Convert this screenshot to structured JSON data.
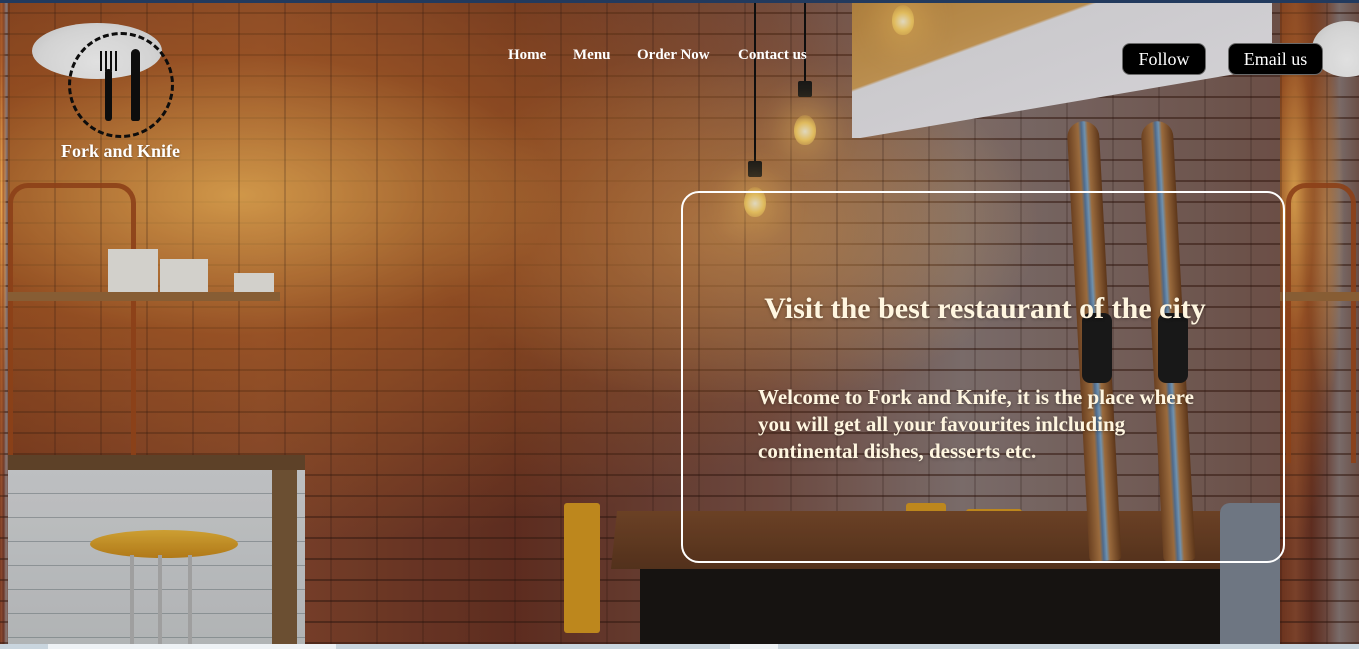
{
  "brand": {
    "name": "Fork and Knife",
    "logo_icon": "fork-and-knife-icon"
  },
  "nav": {
    "items": [
      {
        "label": "Home"
      },
      {
        "label": "Menu"
      },
      {
        "label": "Order Now"
      },
      {
        "label": "Contact us"
      }
    ]
  },
  "actions": {
    "follow_label": "Follow",
    "email_label": "Email us"
  },
  "hero": {
    "title": "Visit the best restaurant of the city",
    "body": "Welcome to Fork and Knife, it is the place where you will get all your favourites inlcluding continental dishes, desserts etc."
  },
  "colors": {
    "button_bg": "#000000",
    "text": "#ffffff",
    "hero_text": "#fff6e0"
  }
}
